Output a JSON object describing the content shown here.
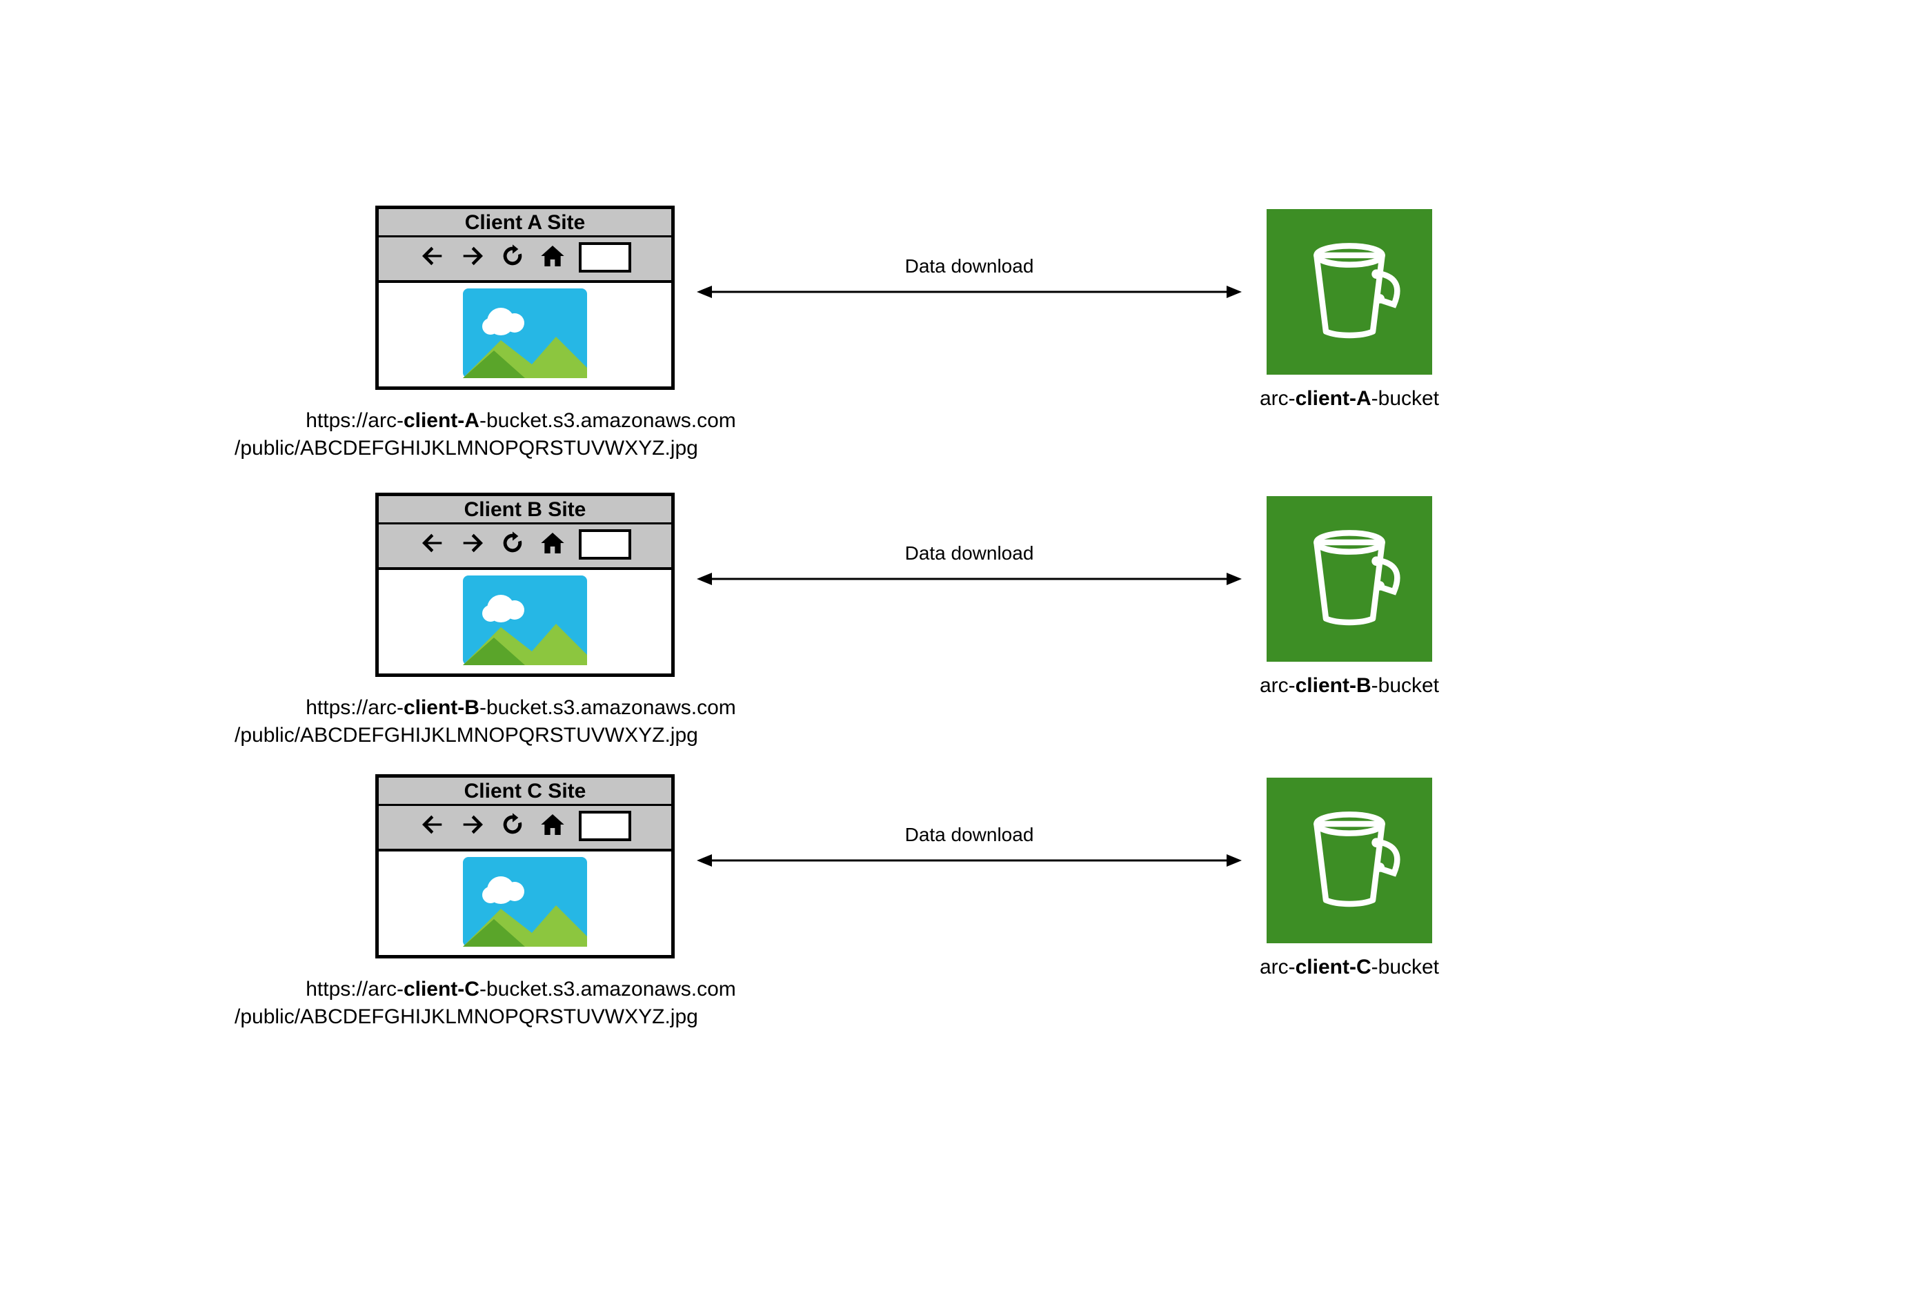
{
  "rows": [
    {
      "browser_title": "Client A Site",
      "url_prefix": "https://arc-",
      "url_bold": "client-A",
      "url_suffix": "-bucket.s3.amazonaws.com",
      "url_line2": "/public/ABCDEFGHIJKLMNOPQRSTUVWXYZ.jpg",
      "arrow_label": "Data download",
      "bucket_prefix": "arc-",
      "bucket_bold": "client-A",
      "bucket_suffix": "-bucket"
    },
    {
      "browser_title": "Client B Site",
      "url_prefix": "https://arc-",
      "url_bold": "client-B",
      "url_suffix": "-bucket.s3.amazonaws.com",
      "url_line2": "/public/ABCDEFGHIJKLMNOPQRSTUVWXYZ.jpg",
      "arrow_label": "Data download",
      "bucket_prefix": "arc-",
      "bucket_bold": "client-B",
      "bucket_suffix": "-bucket"
    },
    {
      "browser_title": "Client C Site",
      "url_prefix": "https://arc-",
      "url_bold": "client-C",
      "url_suffix": "-bucket.s3.amazonaws.com",
      "url_line2": "/public/ABCDEFGHIJKLMNOPQRSTUVWXYZ.jpg",
      "arrow_label": "Data download",
      "bucket_prefix": "arc-",
      "bucket_bold": "client-C",
      "bucket_suffix": "-bucket"
    }
  ],
  "colors": {
    "s3_green": "#3d8e25",
    "toolbar_gray": "#c5c5c5"
  }
}
